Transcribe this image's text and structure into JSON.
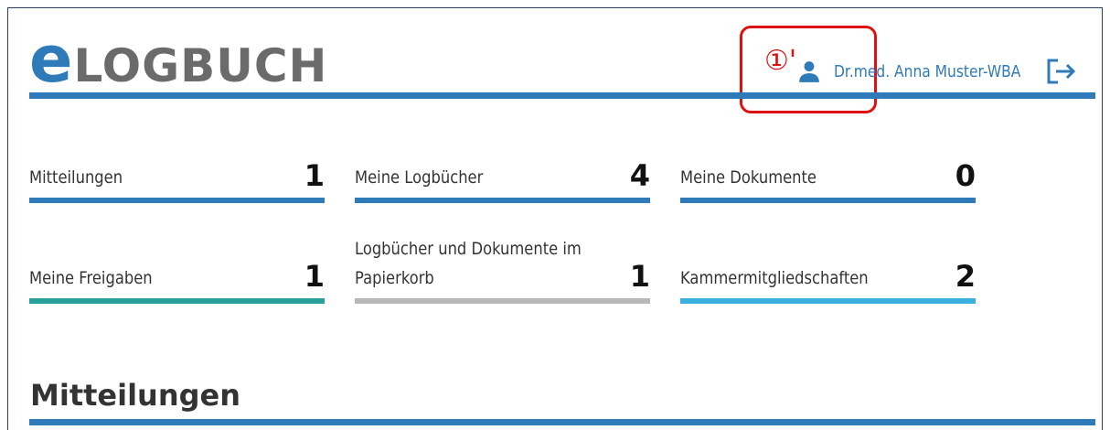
{
  "logo": {
    "e": "e",
    "rest": "LOGBUCH"
  },
  "header": {
    "user_name": "Dr.med. Anna Muster-WBA",
    "user_icon": "person-icon",
    "logout_icon": "logout-icon"
  },
  "annotation": {
    "marker": "①'"
  },
  "cards": [
    {
      "label": "Mitteilungen",
      "count": "1",
      "color": "#2f7ab8"
    },
    {
      "label": "Meine Logbücher",
      "count": "4",
      "color": "#2f7ab8"
    },
    {
      "label": "Meine Dokumente",
      "count": "0",
      "color": "#2f7ab8"
    },
    {
      "label": "Meine Freigaben",
      "count": "1",
      "color": "#2aa198"
    },
    {
      "label_line1": "Logbücher und Dokumente im",
      "label_line2": "Papierkorb",
      "count": "1",
      "color": "#b8b8b8"
    },
    {
      "label": "Kammermitgliedschaften",
      "count": "2",
      "color": "#3ab0e0"
    }
  ],
  "section": {
    "title": "Mitteilungen"
  },
  "colors": {
    "accent": "#2f7ab8",
    "annotation": "#e01010"
  }
}
